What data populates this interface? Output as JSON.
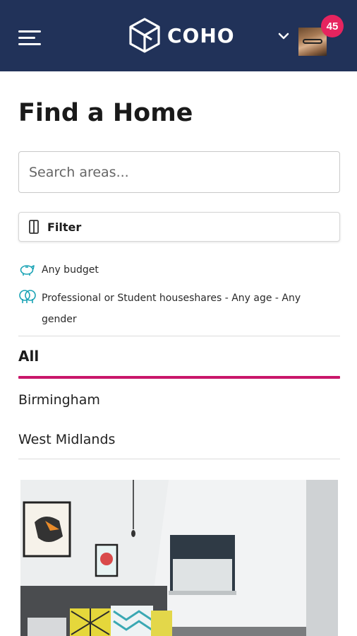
{
  "header": {
    "brand": "COHO",
    "notification_count": "45"
  },
  "page": {
    "title": "Find a Home"
  },
  "search": {
    "placeholder": "Search areas..."
  },
  "filter": {
    "label": "Filter"
  },
  "criteria": {
    "budget": "Any budget",
    "household": "Professional or Student houseshares - Any age - Any gender"
  },
  "tabs": {
    "active": "All"
  },
  "areas": [
    "Birmingham",
    "West Midlands"
  ],
  "colors": {
    "header_bg": "#213259",
    "accent_pink": "#c9176a",
    "badge": "#e6245f",
    "icon_teal": "#1aa3b5"
  },
  "icons": [
    "menu-icon",
    "coho-logo-icon",
    "chevron-down-icon",
    "filter-icon",
    "piggy-bank-icon",
    "people-icon"
  ]
}
